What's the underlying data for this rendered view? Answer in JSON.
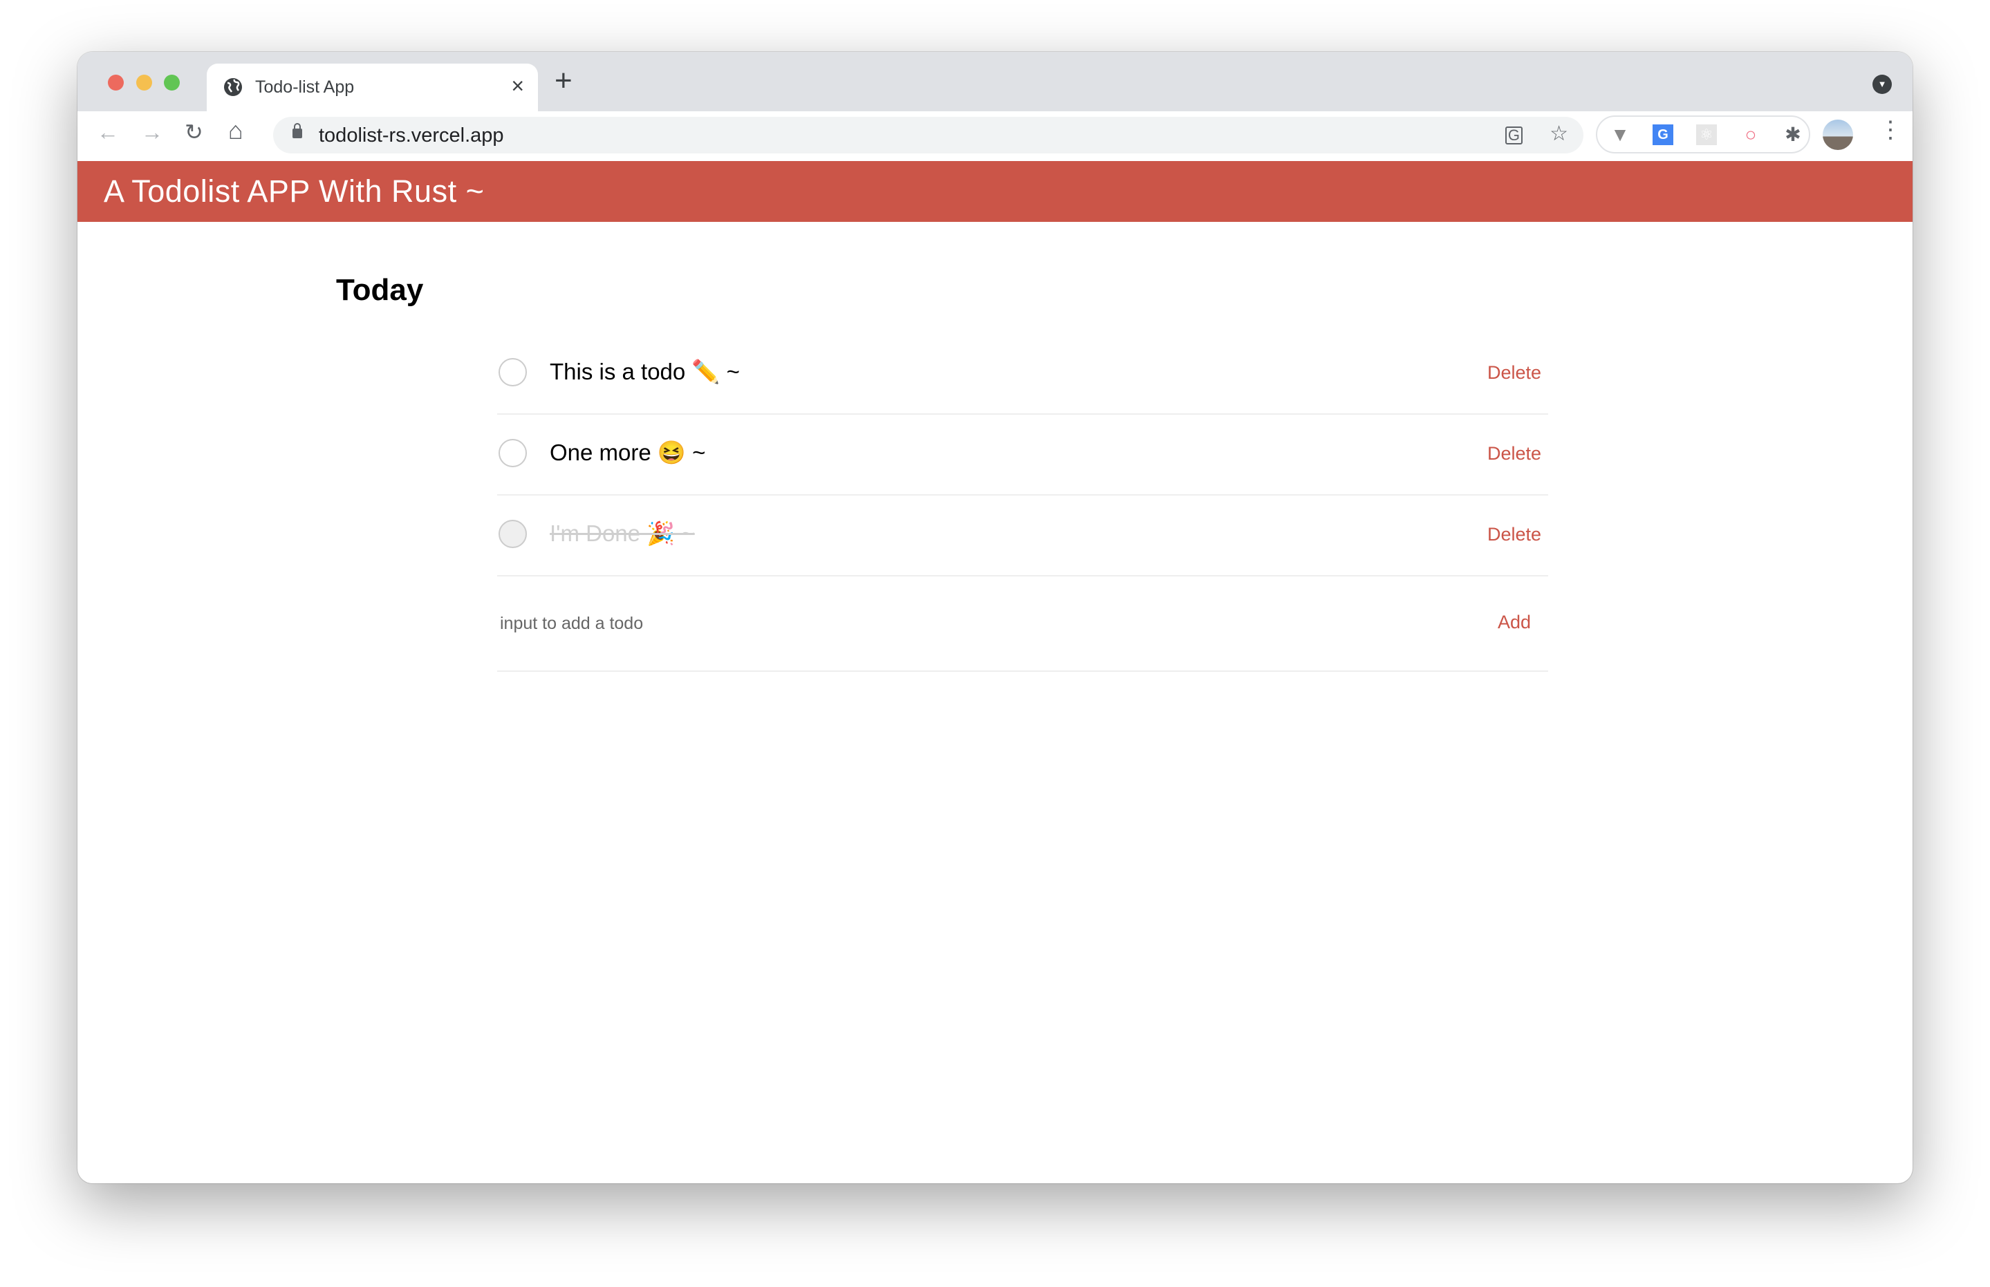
{
  "browser": {
    "tab_title": "Todo-list App",
    "tab_close": "×",
    "new_tab": "+",
    "url": "todolist-rs.vercel.app",
    "nav": {
      "back": "←",
      "forward": "→",
      "reload": "↻",
      "home": "⌂"
    },
    "extensions": [
      "vue-devtools-icon",
      "google-translate-icon",
      "react-devtools-icon",
      "ring-extension-icon",
      "puzzle-extensions-icon"
    ],
    "traffic_lights": {
      "close": "#ed6a5e",
      "minimize": "#f5bf4f",
      "maximize": "#61c554"
    }
  },
  "app": {
    "header_title": "A Todolist APP With Rust ~",
    "brand_color": "#cb5548",
    "section_title": "Today",
    "todos": [
      {
        "text": "This is a todo ✏️ ~",
        "done": false,
        "delete_label": "Delete"
      },
      {
        "text": "One more 😆 ~",
        "done": false,
        "delete_label": "Delete"
      },
      {
        "text": "I'm Done 🎉 ~",
        "done": true,
        "delete_label": "Delete"
      }
    ],
    "add": {
      "placeholder": "input to add a todo",
      "value": "",
      "button_label": "Add"
    }
  }
}
